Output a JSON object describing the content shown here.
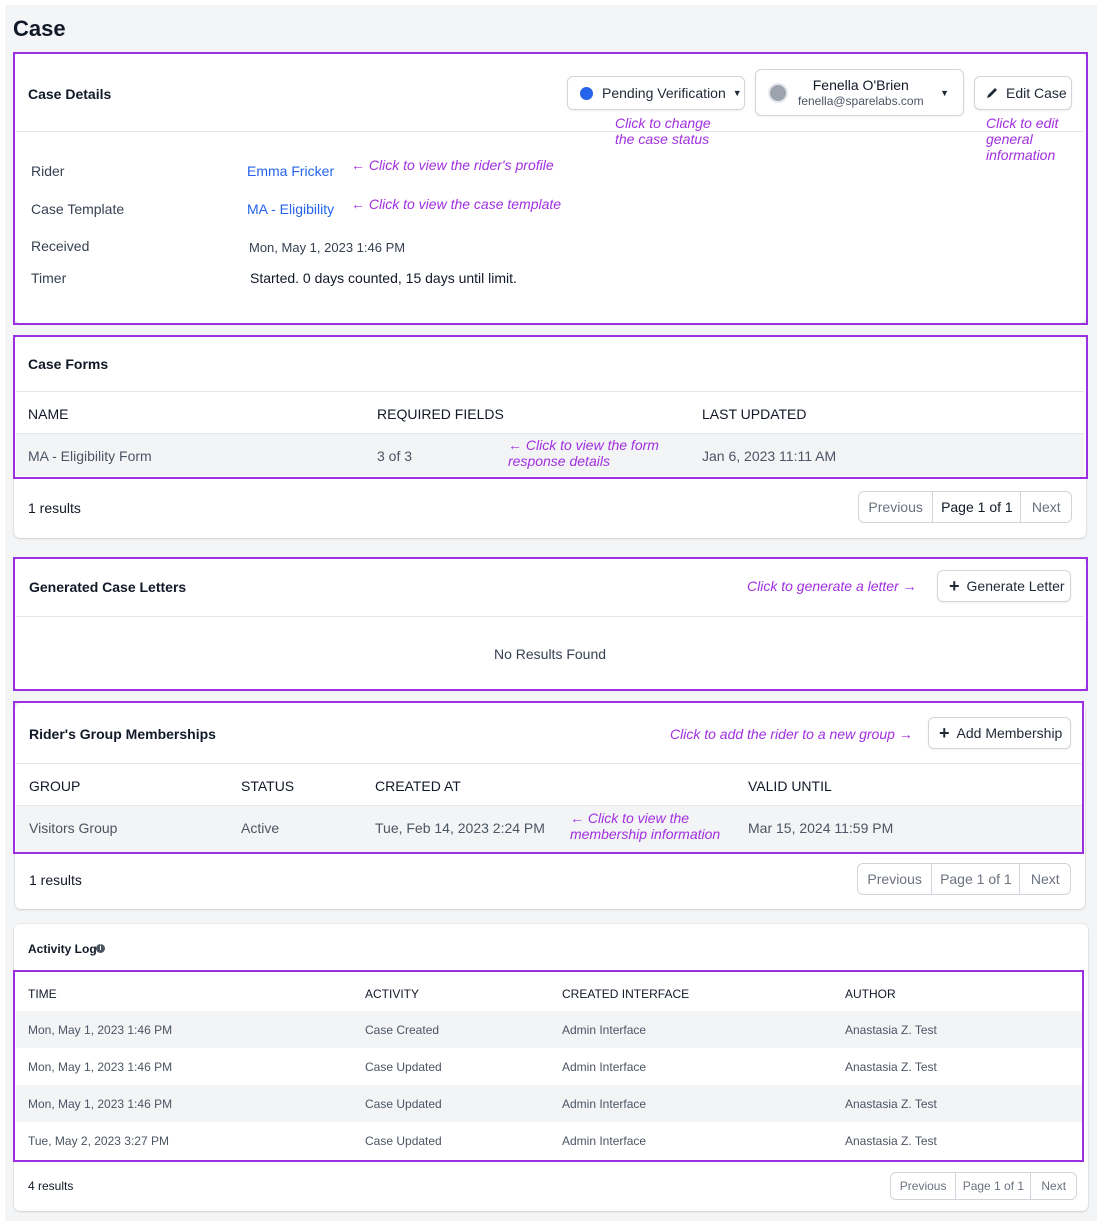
{
  "page": {
    "title": "Case"
  },
  "case_details": {
    "title": "Case Details",
    "status_label": "Pending Verification",
    "status_color": "#2563eb",
    "agent_name": "Fenella O'Brien",
    "agent_email": "fenella@sparelabs.com",
    "edit_label": "Edit Case",
    "fields": [
      {
        "label": "Rider",
        "value": "Emma Fricker"
      },
      {
        "label": "Case Template",
        "value": "MA - Eligibility"
      },
      {
        "label": "Received",
        "value": "Mon, May 1, 2023 1:46 PM"
      },
      {
        "label": "Timer",
        "value": "Started. 0 days counted, 15 days until limit."
      }
    ],
    "notes": {
      "status_line1": "Click to change",
      "status_line2": "the case status",
      "edit_line1": "Click to edit",
      "edit_line2": "general",
      "edit_line3": "information",
      "rider": "← Click to view the rider's profile",
      "template": "← Click to view the case template"
    }
  },
  "case_forms": {
    "title": "Case Forms",
    "columns": [
      "NAME",
      "REQUIRED FIELDS",
      "LAST UPDATED"
    ],
    "rows": [
      {
        "name": "MA - Eligibility Form",
        "required": "3 of 3",
        "updated": "Jan 6, 2023 11:11 AM"
      }
    ],
    "note_line1": "← Click to view the form",
    "note_line2": "response details",
    "results": "1 results",
    "pager": {
      "prev": "Previous",
      "page": "Page 1 of 1",
      "next": "Next"
    }
  },
  "letters": {
    "title": "Generated Case Letters",
    "note": "Click to generate a letter →",
    "button": "Generate Letter",
    "empty": "No Results Found"
  },
  "memberships": {
    "title": "Rider's Group Memberships",
    "note": "Click to add the rider to a new group →",
    "button": "Add Membership",
    "columns": [
      "GROUP",
      "STATUS",
      "CREATED AT",
      "VALID UNTIL"
    ],
    "rows": [
      {
        "group": "Visitors Group",
        "status": "Active",
        "created": "Tue, Feb 14, 2023 2:24 PM",
        "valid": "Mar 15, 2024 11:59 PM"
      }
    ],
    "note_line1": "← Click to view the",
    "note_line2": "membership information",
    "results": "1 results",
    "pager": {
      "prev": "Previous",
      "page": "Page 1 of 1",
      "next": "Next"
    }
  },
  "activity": {
    "title": "Activity Log",
    "columns": [
      "TIME",
      "ACTIVITY",
      "CREATED INTERFACE",
      "AUTHOR"
    ],
    "rows": [
      {
        "time": "Mon, May 1, 2023 1:46 PM",
        "activity": "Case Created",
        "interface": "Admin Interface",
        "author": "Anastasia Z. Test"
      },
      {
        "time": "Mon, May 1, 2023 1:46 PM",
        "activity": "Case Updated",
        "interface": "Admin Interface",
        "author": "Anastasia Z. Test"
      },
      {
        "time": "Mon, May 1, 2023 1:46 PM",
        "activity": "Case Updated",
        "interface": "Admin Interface",
        "author": "Anastasia Z. Test"
      },
      {
        "time": "Tue, May 2, 2023 3:27 PM",
        "activity": "Case Updated",
        "interface": "Admin Interface",
        "author": "Anastasia Z. Test"
      }
    ],
    "results": "4 results",
    "pager": {
      "prev": "Previous",
      "page": "Page 1 of 1",
      "next": "Next"
    }
  },
  "colors": {
    "highlight": "#9b30e0",
    "link": "#2563eb",
    "annotation": "#a12fe0"
  }
}
